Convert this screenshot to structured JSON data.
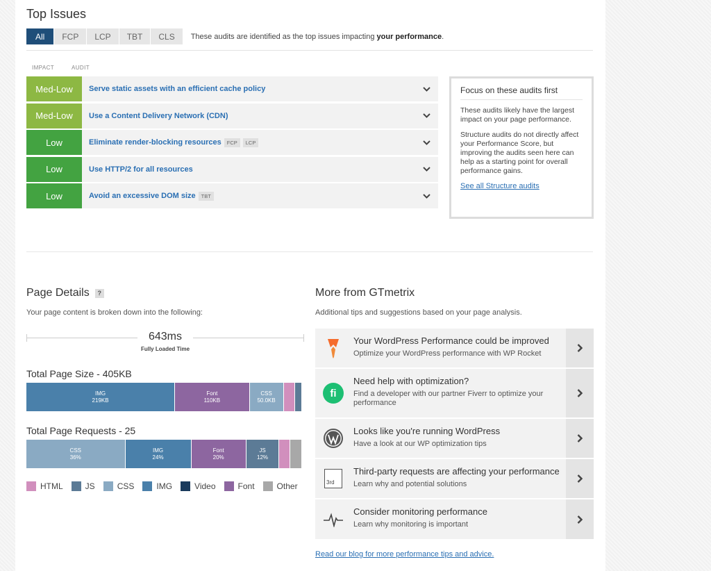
{
  "colors": {
    "med_low": "#8db843",
    "low": "#43a341",
    "active_tab": "#1f4e79",
    "link": "#2a6fb3"
  },
  "top_issues": {
    "title": "Top Issues",
    "tabs": [
      "All",
      "FCP",
      "LCP",
      "TBT",
      "CLS"
    ],
    "active_tab": "All",
    "desc_prefix": "These audits are identified as the top issues impacting ",
    "desc_bold": "your performance",
    "desc_suffix": ".",
    "col_impact": "IMPACT",
    "col_audit": "AUDIT",
    "audits": [
      {
        "impact": "Med-Low",
        "name": "Serve static assets with an efficient cache policy",
        "tags": []
      },
      {
        "impact": "Med-Low",
        "name": "Use a Content Delivery Network (CDN)",
        "tags": []
      },
      {
        "impact": "Low",
        "name": "Eliminate render-blocking resources",
        "tags": [
          "FCP",
          "LCP"
        ]
      },
      {
        "impact": "Low",
        "name": "Use HTTP/2 for all resources",
        "tags": []
      },
      {
        "impact": "Low",
        "name": "Avoid an excessive DOM size",
        "tags": [
          "TBT"
        ]
      }
    ]
  },
  "focus_box": {
    "title": "Focus on these audits first",
    "p1": "These audits likely have the largest impact on your page performance.",
    "p2": "Structure audits do not directly affect your Performance Score, but improving the audits seen here can help as a starting point for overall performance gains.",
    "link": "See all Structure audits"
  },
  "page_details": {
    "title": "Page Details",
    "help": "?",
    "subtitle": "Your page content is broken down into the following:",
    "fully_loaded_value": "643ms",
    "fully_loaded_label": "Fully Loaded Time",
    "size_title": "Total Page Size - 405KB",
    "requests_title": "Total Page Requests - 25",
    "size_segments": [
      {
        "type": "IMG",
        "label": "IMG",
        "value": "219KB",
        "share": 219
      },
      {
        "type": "Font",
        "label": "Font",
        "value": "110KB",
        "share": 110
      },
      {
        "type": "CSS",
        "label": "CSS",
        "value": "50.0KB",
        "share": 50
      },
      {
        "type": "HTML",
        "label": "",
        "value": "",
        "share": 17
      },
      {
        "type": "JS",
        "label": "",
        "value": "",
        "share": 9
      }
    ],
    "request_segments": [
      {
        "type": "CSS",
        "label": "CSS",
        "value": "36%",
        "share": 36
      },
      {
        "type": "IMG",
        "label": "IMG",
        "value": "24%",
        "share": 24
      },
      {
        "type": "Font",
        "label": "Font",
        "value": "20%",
        "share": 20
      },
      {
        "type": "JS",
        "label": "JS",
        "value": "12%",
        "share": 12
      },
      {
        "type": "HTML",
        "label": "",
        "value": "",
        "share": 4
      },
      {
        "type": "Other",
        "label": "",
        "value": "",
        "share": 4
      }
    ],
    "legend": [
      {
        "name": "HTML",
        "color": "#d18fbd"
      },
      {
        "name": "JS",
        "color": "#5c7b96"
      },
      {
        "name": "CSS",
        "color": "#8aaac3"
      },
      {
        "name": "IMG",
        "color": "#4a80aa"
      },
      {
        "name": "Video",
        "color": "#1a3a5c"
      },
      {
        "name": "Font",
        "color": "#8d66a0"
      },
      {
        "name": "Other",
        "color": "#a8a8a8"
      }
    ]
  },
  "more_from": {
    "title": "More from GTmetrix",
    "subtitle": "Additional tips and suggestions based on your page analysis.",
    "items": [
      {
        "icon": "wp-rocket-icon",
        "title": "Your WordPress Performance could be improved",
        "desc": "Optimize your WordPress performance with WP Rocket"
      },
      {
        "icon": "fiverr-icon",
        "title": "Need help with optimization?",
        "desc": "Find a developer with our partner Fiverr to optimize your performance"
      },
      {
        "icon": "wordpress-icon",
        "title": "Looks like you're running WordPress",
        "desc": "Have a look at our WP optimization tips"
      },
      {
        "icon": "third-party-icon",
        "title": "Third-party requests are affecting your performance",
        "desc": "Learn why and potential solutions"
      },
      {
        "icon": "heartbeat-icon",
        "title": "Consider monitoring performance",
        "desc": "Learn why monitoring is important"
      }
    ],
    "third_party_badge": "3rd",
    "fiverr_badge": "fi",
    "footer_link": "Read our blog for more performance tips and advice."
  }
}
